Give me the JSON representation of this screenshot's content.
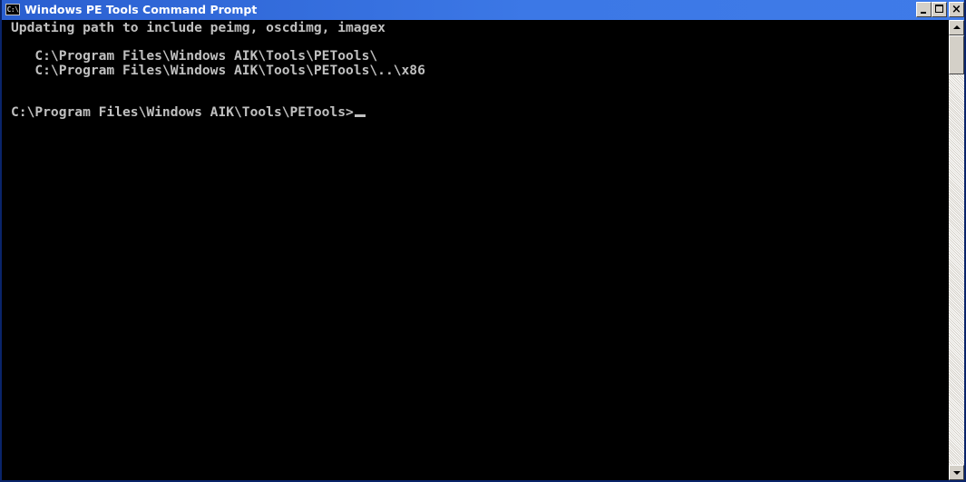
{
  "window": {
    "title": "Windows PE Tools Command Prompt",
    "icon": "cmd-console-icon",
    "icon_text": "C:\\",
    "controls": {
      "minimize_icon": "minimize-icon",
      "maximize_icon": "maximize-icon",
      "close_icon": "close-icon",
      "close_glyph": "×"
    }
  },
  "console": {
    "background": "#000000",
    "foreground": "#c0c0c0",
    "lines": [
      "Updating path to include peimg, oscdimg, imagex",
      "",
      "   C:\\Program Files\\Windows AIK\\Tools\\PETools\\",
      "   C:\\Program Files\\Windows AIK\\Tools\\PETools\\..\\x86",
      "",
      "",
      "C:\\Program Files\\Windows AIK\\Tools\\PETools>"
    ]
  },
  "scrollbar": {
    "up_icon": "scroll-up-arrow-icon",
    "down_icon": "scroll-down-arrow-icon"
  },
  "colors": {
    "titlebar": "#3c78e6",
    "title_text": "#ffffff",
    "chrome": "#d4d0c8"
  }
}
